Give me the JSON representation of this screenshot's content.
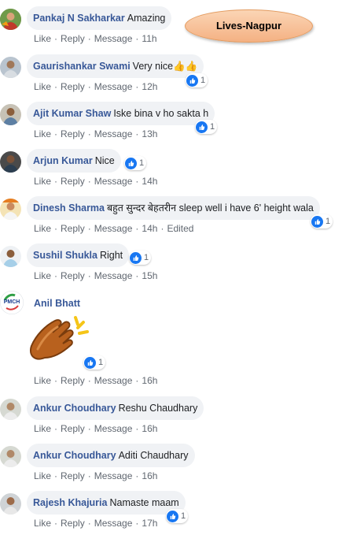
{
  "overlay_badge": "Lives-Nagpur",
  "actions": {
    "like": "Like",
    "reply": "Reply",
    "message": "Message"
  },
  "colors": {
    "author": "#385898",
    "like_blue": "#1877f2",
    "bubble": "#f0f2f5",
    "badge": "#f4b183"
  },
  "comments": [
    {
      "author": "Pankaj N Sakharkar",
      "text": "Amazing",
      "time": "11h"
    },
    {
      "author": "Gaurishankar Swami",
      "text": "Very nice👍👍",
      "time": "12h",
      "likes": "1"
    },
    {
      "author": "Ajit Kumar Shaw",
      "text": "Iske bina v ho sakta h",
      "time": "13h",
      "likes": "1"
    },
    {
      "author": "Arjun Kumar",
      "text": "Nice",
      "time": "14h",
      "likes": "1"
    },
    {
      "author": "Dinesh Sharma",
      "text": "बहुत सुन्दर बेहतरीन sleep well i have 6' height wala",
      "time": "14h",
      "edited": "Edited",
      "likes": "1"
    },
    {
      "author": "Sushil Shukla",
      "text": "Right",
      "time": "15h",
      "likes": "1"
    },
    {
      "author": "Anil Bhatt",
      "text": "",
      "time": "16h",
      "likes": "1",
      "sticker": "clapping-hands",
      "avatar_text": "PMCH"
    },
    {
      "author": "Ankur Choudhary",
      "text": "Reshu Chaudhary",
      "time": "16h"
    },
    {
      "author": "Ankur Choudhary",
      "text": "Aditi Chaudhary",
      "time": "16h"
    },
    {
      "author": "Rajesh Khajuria",
      "text": "Namaste maam",
      "time": "17h",
      "likes": "1"
    }
  ]
}
